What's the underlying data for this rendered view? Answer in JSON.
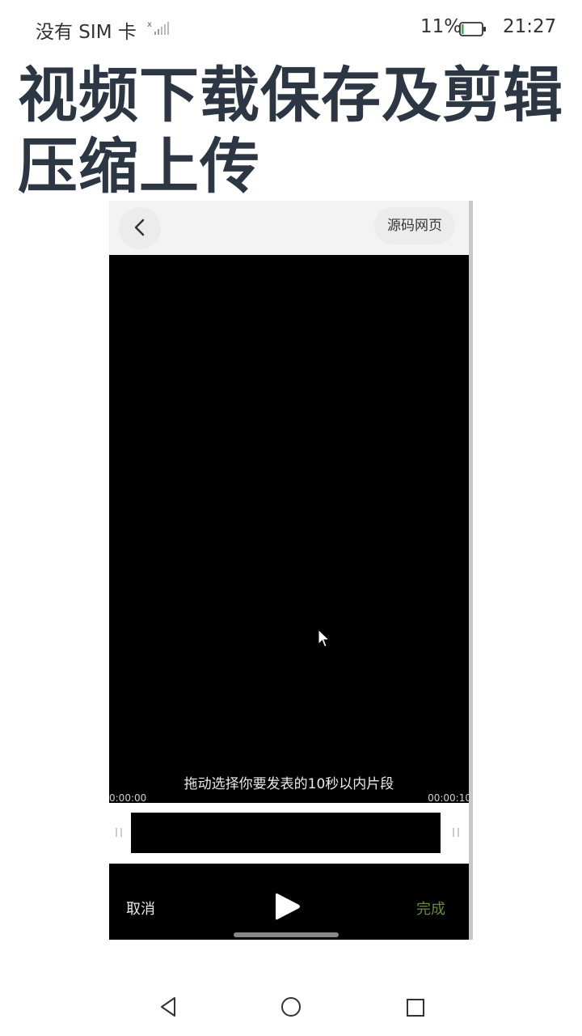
{
  "status_bar": {
    "carrier": "没有 SIM 卡",
    "battery_percent": "11%",
    "time": "21:27",
    "battery_level": 0.11,
    "icons": [
      "signal-icon",
      "battery-icon"
    ]
  },
  "page": {
    "title": "视频下载保存及剪辑压缩上传"
  },
  "app": {
    "header": {
      "back_icon": "chevron-left-icon",
      "source_button_label": "源码网页"
    },
    "editor": {
      "hint": "拖动选择你要发表的10秒以内片段",
      "time_start": "0:00:00",
      "time_end": "00:00:10",
      "cancel_label": "取消",
      "done_label": "完成",
      "play_icon": "play-icon",
      "cursor_icon": "mouse-cursor-icon",
      "done_color": "#6d8a35"
    }
  },
  "nav_bar": {
    "icons": [
      "back-triangle-icon",
      "home-circle-icon",
      "recents-square-icon"
    ]
  }
}
